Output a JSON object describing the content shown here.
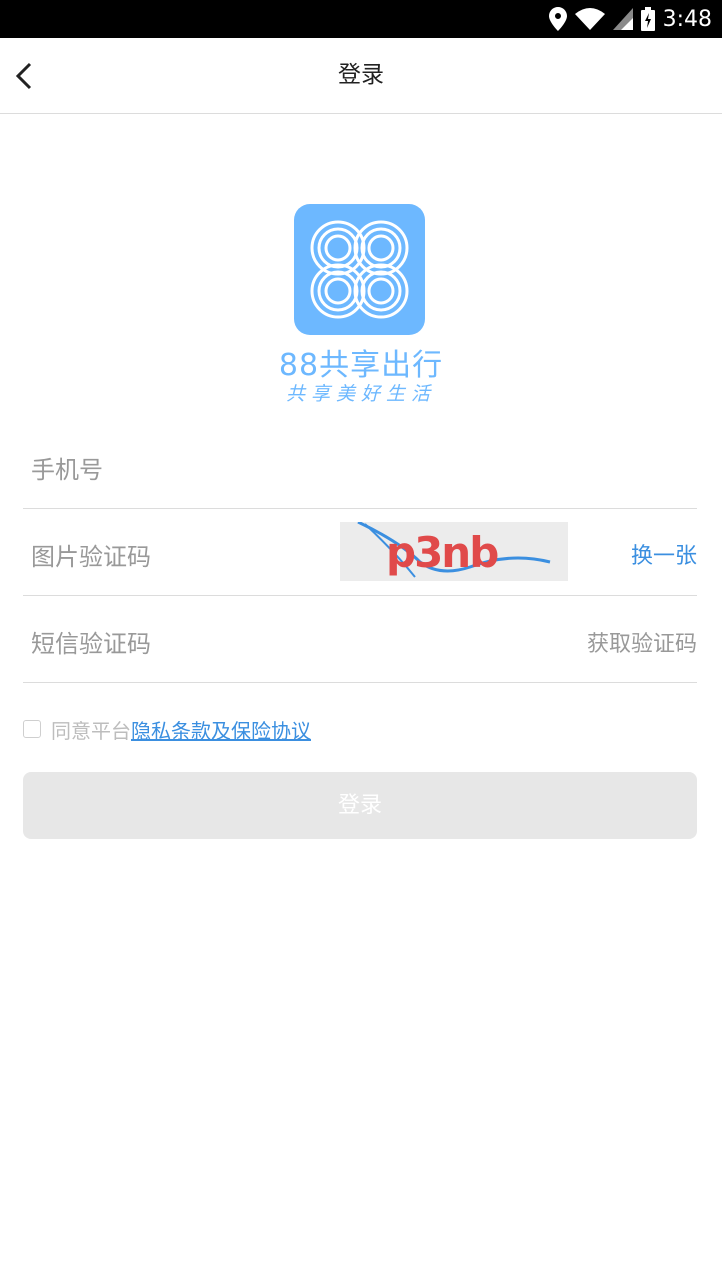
{
  "status_bar": {
    "time": "3:48",
    "icons": [
      "location-icon",
      "wifi-icon",
      "signal-icon",
      "battery-icon"
    ]
  },
  "header": {
    "title": "登录",
    "back_icon": "chevron-left-icon"
  },
  "brand": {
    "name": "88共享出行",
    "slogan": "共享美好生活",
    "color": "#6db8ff"
  },
  "form": {
    "phone_placeholder": "手机号",
    "image_code_placeholder": "图片验证码",
    "captcha_text": "p3nb",
    "refresh_captcha_label": "换一张",
    "sms_code_placeholder": "短信验证码",
    "get_sms_code_label": "获取验证码"
  },
  "agreement": {
    "checked": false,
    "prefix": "同意平台",
    "link_text": "隐私条款及保险协议"
  },
  "login_button_label": "登录",
  "colors": {
    "link": "#3b8fe0",
    "button_disabled": "#e7e7e7"
  }
}
